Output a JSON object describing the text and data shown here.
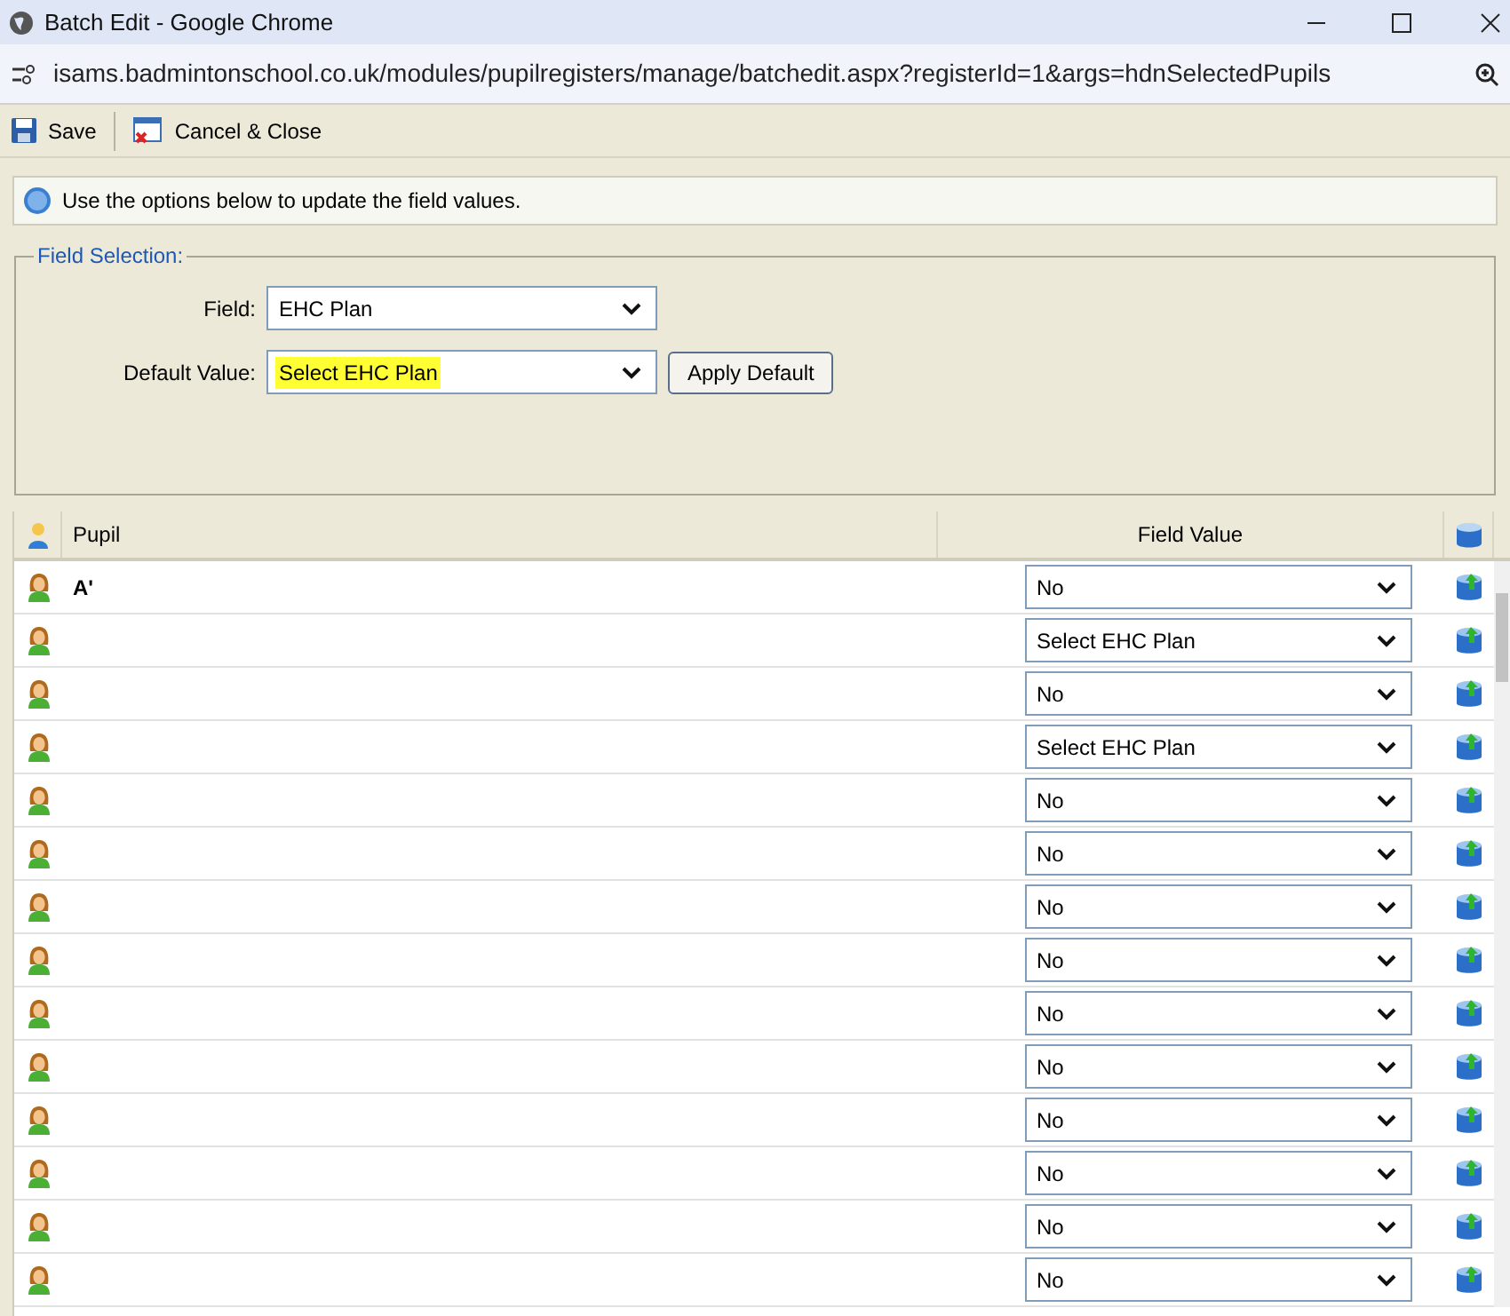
{
  "window": {
    "title": "Batch Edit - Google Chrome"
  },
  "address_bar": {
    "url": "isams.badmintonschool.co.uk/modules/pupilregisters/manage/batchedit.aspx?registerId=1&args=hdnSelectedPupils"
  },
  "toolbar": [
    {
      "label": "Save",
      "kind": "save"
    },
    {
      "label": "Cancel & Close",
      "kind": "cancel"
    }
  ],
  "info": {
    "text": "Use the options below to update the field values."
  },
  "field_selection": {
    "legend": "Field Selection:",
    "field": {
      "label": "Field:",
      "value": "EHC Plan"
    },
    "default_value": {
      "label": "Default Value:",
      "value": "Select EHC Plan",
      "highlighted": true
    },
    "apply_button": "Apply Default"
  },
  "table": {
    "columns": [
      "Pupil",
      "Field Value"
    ],
    "rows": [
      {
        "pupil": "A'",
        "value": "No"
      },
      {
        "value": "Select EHC Plan"
      },
      {
        "value": "No"
      },
      {
        "value": "Select EHC Plan"
      },
      {
        "value": "No"
      },
      {
        "value": "No"
      },
      {
        "value": "No"
      },
      {
        "value": "No"
      },
      {
        "value": "No"
      },
      {
        "value": "No"
      },
      {
        "value": "No"
      },
      {
        "value": "No"
      },
      {
        "value": "No"
      },
      {
        "value": "No"
      }
    ]
  }
}
